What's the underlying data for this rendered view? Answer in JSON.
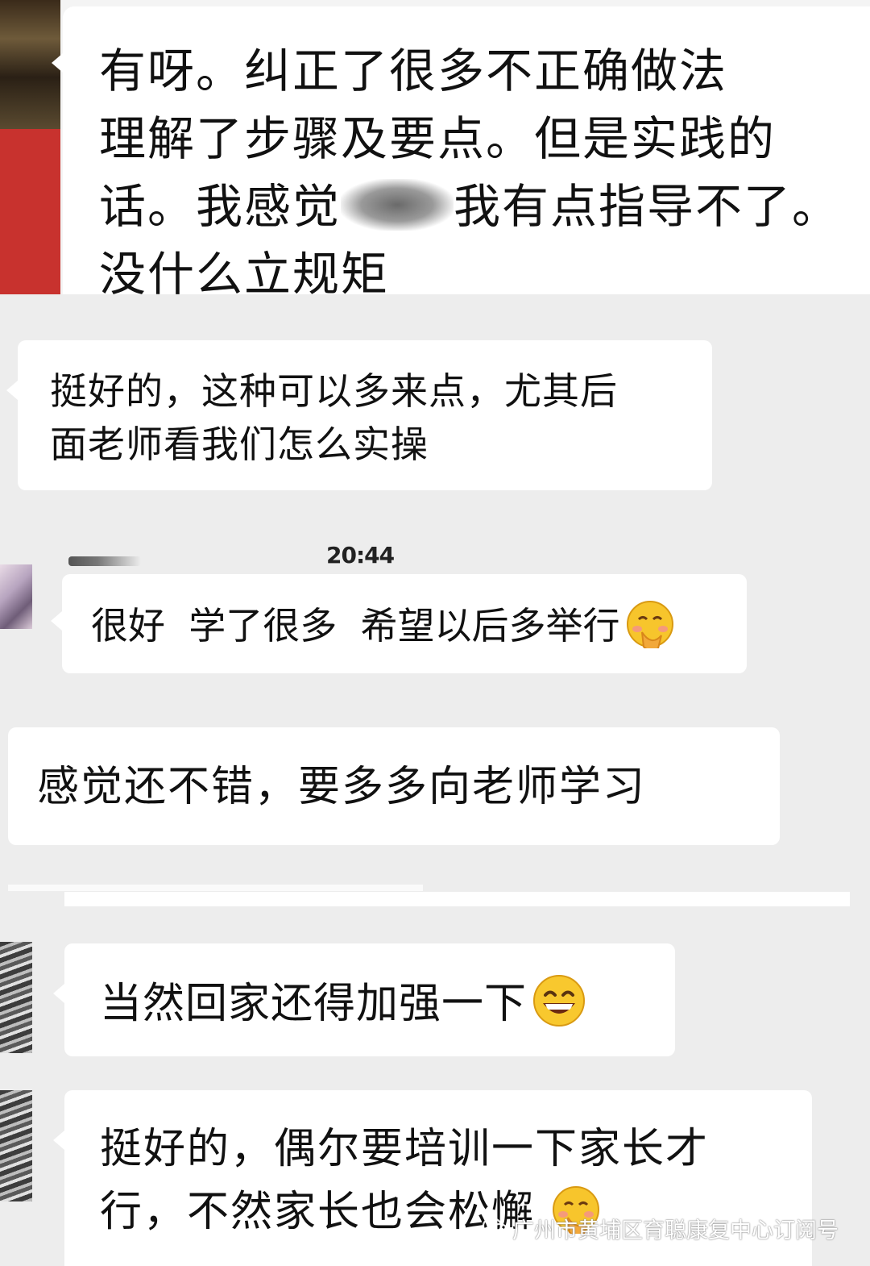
{
  "messages": [
    {
      "text": "有呀。纠正了很多不正确做法\n理解了步骤及要点。但是实践的\n话。我感觉",
      "text_after_blur": "我有点指导不了。\n没什么立规矩"
    },
    {
      "text": "挺好的，这种可以多来点，尤其后\n面老师看我们怎么实操"
    },
    {
      "text": "很好  学了很多  希望以后多举行",
      "emoji": "blushing-face-with-hand-emoji"
    },
    {
      "text": "感觉还不错，要多多向老师学习"
    },
    {
      "text": "当然回家还得加强一下",
      "emoji": "grinning-face-emoji"
    },
    {
      "text": "挺好的，偶尔要培训一下家长才\n行，不然家长也会松懈",
      "emoji": "blushing-face-with-hand-emoji"
    }
  ],
  "timestamp": "20:44",
  "watermark": "广州市黄埔区育聪康复中心订阅号",
  "colors": {
    "background": "#ededed",
    "bubble": "#ffffff",
    "text": "#111111",
    "red_avatar": "#c8322e"
  }
}
